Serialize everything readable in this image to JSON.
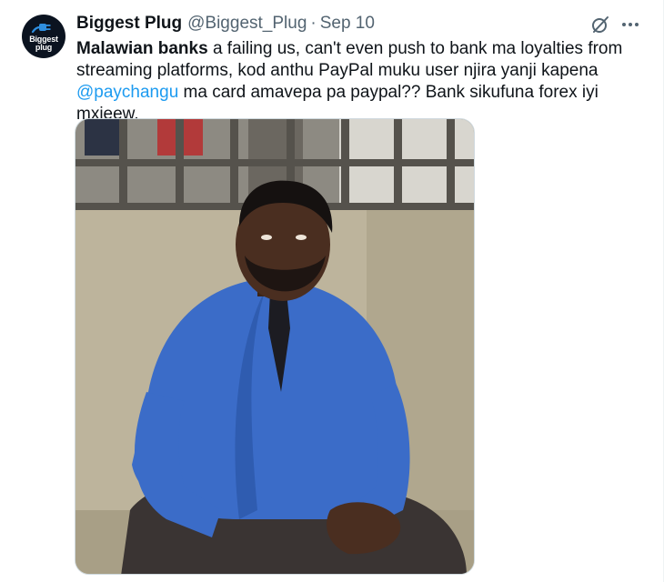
{
  "tweet": {
    "author": {
      "display_name": "Biggest Plug",
      "handle": "@Biggest_Plug",
      "separator": "·",
      "date": "Sep 10",
      "avatar_text_line1": "Biggest",
      "avatar_text_line2": "plug"
    },
    "body": {
      "bold_part": "Malawian banks",
      "part1": " a failing us, can't even push to bank ma loyalties from streaming platforms, kod anthu PayPal muku user njira yanji kapena ",
      "mention": "@paychangu",
      "part2": " ma card amavepa pa paypal?? Bank sikufuna forex iyi mxieew."
    },
    "actions": {
      "grok_icon": "grok-icon",
      "more_icon": "more-icon"
    },
    "media": {
      "type": "photo",
      "description_icon": "photo-man-in-blue-shirt"
    }
  },
  "colors": {
    "text": "#0f1419",
    "secondary": "#536471",
    "link": "#1d9bf0",
    "shirt": "#3b6cc8"
  }
}
